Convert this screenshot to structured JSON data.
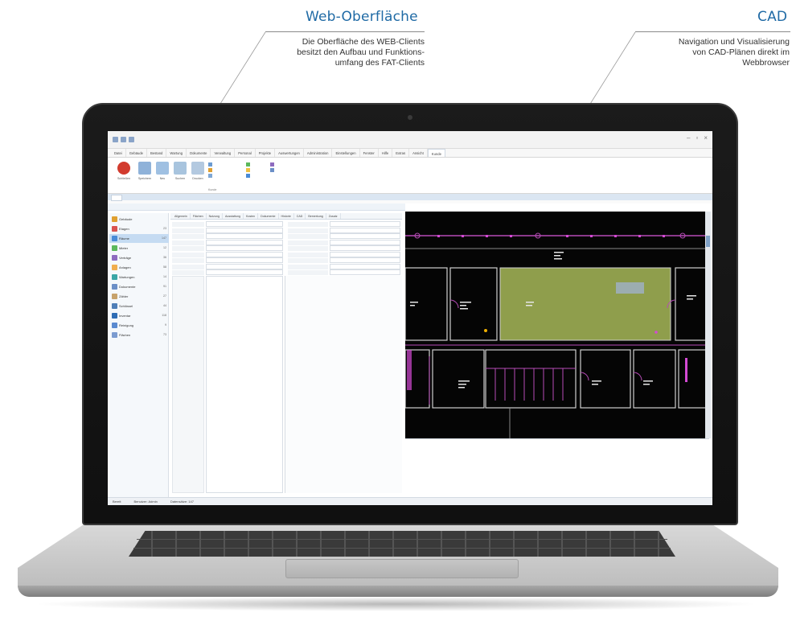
{
  "callouts": {
    "web": {
      "title": "Web-Oberfläche",
      "text": [
        "Die Oberfläche des WEB-Clients",
        "besitzt den Aufbau und Funktions-",
        "umfang des FAT-Clients"
      ]
    },
    "cad": {
      "title": "CAD",
      "text": [
        "Navigation und Visualisierung",
        "von CAD-Plänen direkt im",
        "Webbrowser"
      ]
    }
  },
  "app": {
    "menu_tabs": [
      "Datei",
      "Gebäude",
      "Bestand",
      "Wartung",
      "Dokumente",
      "Verwaltung",
      "Personal",
      "Projekte",
      "Auswertungen",
      "Administration",
      "Einstellungen",
      "Fenster",
      "Hilfe",
      "Extras",
      "Ansicht",
      "Kunde"
    ],
    "active_menu_tab_index": 15,
    "ribbon_buttons": [
      "Schließen",
      "Speichern",
      "Neu",
      "Suchen",
      "Drucken"
    ],
    "ribbon_group_label": "Kunde",
    "nav_items": [
      {
        "label": "Gebäude",
        "count": "",
        "color": "#e0a030"
      },
      {
        "label": "Etagen",
        "count": "23",
        "color": "#d9534f"
      },
      {
        "label": "Räume",
        "count": "147",
        "color": "#4a8bd6"
      },
      {
        "label": "Mieter",
        "count": "12",
        "color": "#5cb85c"
      },
      {
        "label": "Verträge",
        "count": "36",
        "color": "#8e6bbf"
      },
      {
        "label": "Anlagen",
        "count": "58",
        "color": "#f0ad4e"
      },
      {
        "label": "Wartungen",
        "count": "14",
        "color": "#3aa6a6"
      },
      {
        "label": "Dokumente",
        "count": "91",
        "color": "#6b8fc7"
      },
      {
        "label": "Zähler",
        "count": "27",
        "color": "#c7a26b"
      },
      {
        "label": "Schlüssel",
        "count": "44",
        "color": "#4f7fb8"
      },
      {
        "label": "Inventar",
        "count": "118",
        "color": "#2f6db5"
      },
      {
        "label": "Reinigung",
        "count": "9",
        "color": "#5a8ad0"
      },
      {
        "label": "Flächen",
        "count": "73",
        "color": "#7b9bd0"
      }
    ],
    "selected_nav_index": 2,
    "form_tabs": [
      "Allgemein",
      "Flächen",
      "Nutzung",
      "Ausstattung",
      "Kosten",
      "Dokumente",
      "Historie",
      "CAD",
      "Bemerkung",
      "Zusatz"
    ],
    "statusbar": [
      "Bereit",
      "Benutzer: Admin",
      "Datensätze: 147"
    ]
  }
}
